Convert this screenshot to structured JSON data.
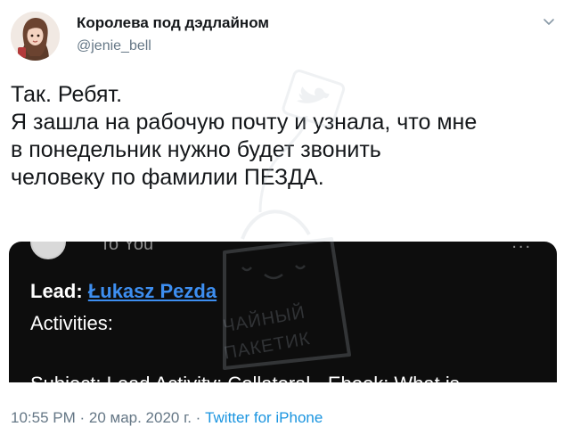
{
  "header": {
    "display_name": "Королева под дэдлайном",
    "handle": "@jenie_bell"
  },
  "tweet": {
    "lines": [
      "Так. Ребят.",
      "Я зашла на рабочую почту и узнала, что мне",
      "в понедельник нужно будет звонить",
      "человеку по фамилии ПЕЗДА."
    ]
  },
  "media": {
    "to_text": "To You",
    "dots": "...",
    "lead_label": "Lead:",
    "lead_value": "Łukasz Pezda",
    "activities_label": "Activities:",
    "subject_line": "Subject: Lead Activity: Collateral - Ebook: What is"
  },
  "footer": {
    "time": "10:55 PM",
    "separator": " · ",
    "date": "20 мар. 2020 г.",
    "source": "Twitter for iPhone"
  },
  "watermark": {
    "line1": "ЧАЙНЫЙ",
    "line2": "ПАКЕТИК"
  },
  "colors": {
    "text": "#14171a",
    "secondary": "#657786",
    "link": "#1b95e0",
    "media_bg": "#0d0d0d",
    "lead_link": "#3d8ef0"
  },
  "icons": [
    "chevron-down-icon",
    "bird-icon",
    "tea-bag-icon"
  ]
}
